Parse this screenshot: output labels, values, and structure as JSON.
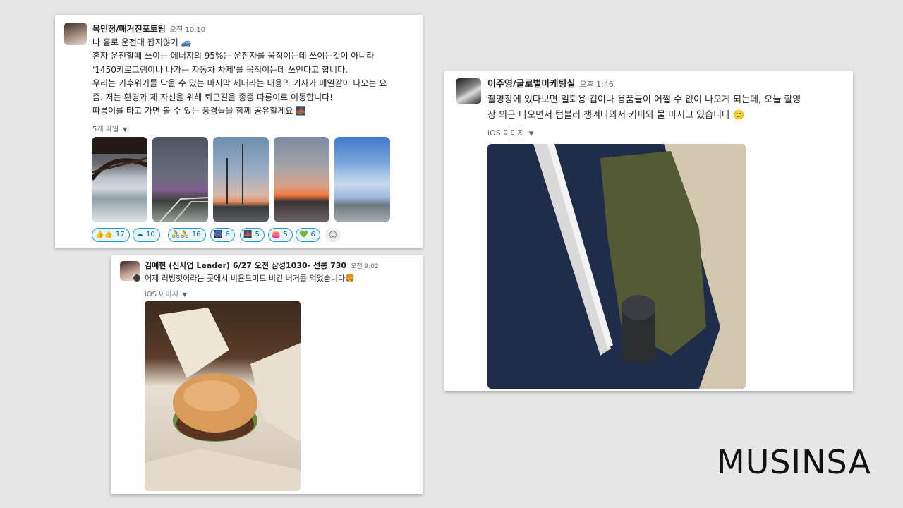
{
  "brand": {
    "logo_text": "MUSINSA"
  },
  "post1": {
    "author": "목민정/매거진포토팀",
    "time": "오전 10:10",
    "lines": [
      "나 홀로 운전대 잡지않기 🚙",
      "혼자 운전할때 쓰이는 에너지의 95%는 운전자를 움직이는데 쓰이는것이 아니라",
      "'1450키로그램이나 나가는 자동차 차제'를 움직이는데 쓰인다고 합니다.",
      "우리는 기후위기를 막을 수 있는 마지막 세대라는 내용의 기사가 매일같이 나오는 요",
      "즘. 저는 환경과 제 자신을 위해 퇴근길을 종종 따릉이로 이동합니다!",
      "따릉이를 타고 가면 볼 수 있는 풍경들을 함께 공유할게요 🌉"
    ],
    "files_label": "5개 파일",
    "reactions": [
      {
        "emoji": "👍👍",
        "count": "17"
      },
      {
        "emoji": "☁",
        "count": "10"
      },
      {
        "emoji": "🚴🚴",
        "count": "16"
      },
      {
        "emoji": "🎆",
        "count": "6"
      },
      {
        "emoji": "🌉",
        "count": "5"
      },
      {
        "emoji": "👛",
        "count": "5"
      },
      {
        "emoji": "💚",
        "count": "6"
      }
    ]
  },
  "post2": {
    "author": "김예현 (신사업 Leader) 6/27 오전 삼성1030- 선릉 730",
    "time": "오전 9:02",
    "line": "어제 러빙헛이라는 곳에서 비욘드미트 비건 버거를 먹었습니다🍔",
    "image_label": "iOS 이미지"
  },
  "post3": {
    "author": "이주영/글로벌마케팅실",
    "time": "오후 1:46",
    "lines": [
      "촬영장에 있다보면 일회용 컵이나 용품들이 어쩔 수 없이 나오게 되는데, 오늘 촬영",
      "장 외근 나오면서 텀블러 챙겨나와서 커피와 물 마시고 있습니다 🙂"
    ],
    "image_label": "iOS 이미지"
  }
}
